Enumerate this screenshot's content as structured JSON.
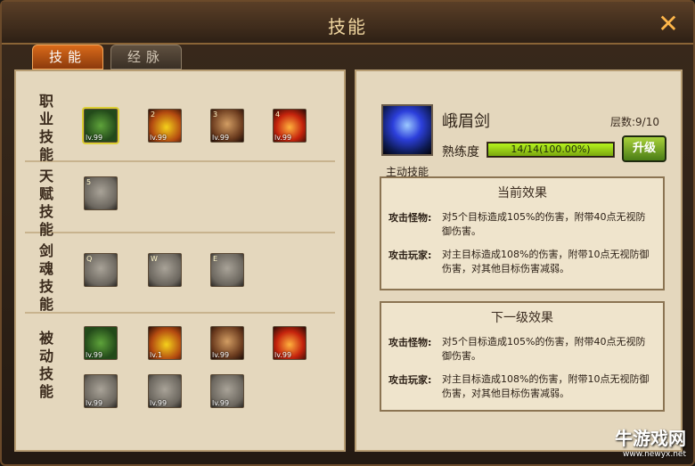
{
  "window": {
    "title": "技能",
    "close_label": "✕"
  },
  "tabs": [
    {
      "label": "技能"
    },
    {
      "label": "经脉"
    }
  ],
  "categories": [
    {
      "label": "职业技能"
    },
    {
      "label": "天赋技能"
    },
    {
      "label": "剑魂技能"
    },
    {
      "label": "被动技能"
    }
  ],
  "skills": {
    "job": [
      {
        "key": "",
        "level": "lv.99",
        "art": "green"
      },
      {
        "key": "2",
        "level": "lv.99",
        "art": "fire"
      },
      {
        "key": "3",
        "level": "lv.99",
        "art": "brown"
      },
      {
        "key": "4",
        "level": "lv.99",
        "art": "red"
      }
    ],
    "talent": [
      {
        "key": "5",
        "level": "",
        "art": "gray"
      }
    ],
    "soul": [
      {
        "key": "Q",
        "level": "",
        "art": "gray"
      },
      {
        "key": "W",
        "level": "",
        "art": "gray"
      },
      {
        "key": "E",
        "level": "",
        "art": "gray"
      }
    ],
    "passive_row1": [
      {
        "key": "",
        "level": "lv.99",
        "art": "green"
      },
      {
        "key": "",
        "level": "lv.1",
        "art": "fire"
      },
      {
        "key": "",
        "level": "lv.99",
        "art": "brown"
      },
      {
        "key": "",
        "level": "lv.99",
        "art": "red"
      }
    ],
    "passive_row2": [
      {
        "key": "",
        "level": "lv.99",
        "art": "gray"
      },
      {
        "key": "",
        "level": "lv.99",
        "art": "gray"
      },
      {
        "key": "",
        "level": "lv.99",
        "art": "gray"
      }
    ]
  },
  "detail": {
    "type_label": "主动技能",
    "name": "峨眉剑",
    "layer_label": "层数:9/10",
    "proficiency_label": "熟练度",
    "proficiency_text": "14/14(100.00%)",
    "proficiency_fraction": 1.0,
    "upgrade_label": "升级",
    "current": {
      "title": "当前效果",
      "rows": [
        {
          "key": "攻击怪物:",
          "value": "对5个目标造成105%的伤害，附带40点无视防御伤害。"
        },
        {
          "key": "攻击玩家:",
          "value": "对主目标造成108%的伤害，附带10点无视防御伤害，对其他目标伤害减弱。"
        }
      ]
    },
    "next": {
      "title": "下一级效果",
      "rows": [
        {
          "key": "攻击怪物:",
          "value": "对5个目标造成105%的伤害，附带40点无视防御伤害。"
        },
        {
          "key": "攻击玩家:",
          "value": "对主目标造成108%的伤害，附带10点无视防御伤害，对其他目标伤害减弱。"
        }
      ]
    }
  },
  "watermark": {
    "text": "牛游戏网",
    "url": "www.newyx.net"
  }
}
